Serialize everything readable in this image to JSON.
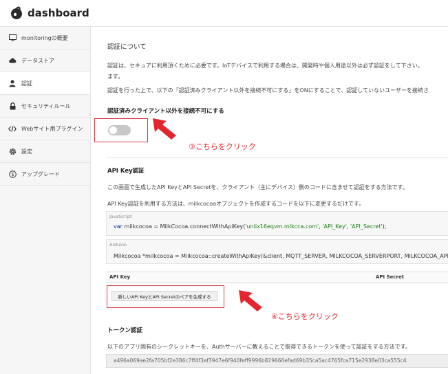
{
  "app": {
    "title": "dashboard"
  },
  "sidebar": {
    "items": [
      {
        "label": "monitoringの概要",
        "icon": "monitor-icon"
      },
      {
        "label": "データストア",
        "icon": "cloud-icon"
      },
      {
        "label": "認証",
        "icon": "user-icon",
        "active": true
      },
      {
        "label": "セキュリティルール",
        "icon": "lock-icon"
      },
      {
        "label": "Webサイト用プラグイン",
        "icon": "code-icon"
      },
      {
        "label": "設定",
        "icon": "gear-icon"
      },
      {
        "label": "アップグレード",
        "icon": "dollar-icon"
      }
    ]
  },
  "auth": {
    "title": "認証について",
    "desc1": "認証は、セキュアに利用頂くために必要です。IoTデバイスで利用する場合は、開発時や個人用途以外は必ず認証をして下さい。",
    "desc1b": "ます。",
    "desc2": "認証を行った上で、以下の「認証済みクライアント以外を接続不可にする」をONにすることで、認証していないユーザーを接続さ",
    "toggle_label": "認証済みクライアント以外を接続不可にする",
    "toggle_on": false
  },
  "annotations": {
    "step3": "③こちらをクリック",
    "step4": "④こちらをクリック",
    "color": "#e3262e"
  },
  "apikey": {
    "title": "API Key認証",
    "desc1": "この画面で生成したAPI KeyとAPI Secretを、クライアント（主にデバイス）側のコードに含ませて認証をする方法です。",
    "desc2": "API Key認証を利用する方法は、milkcocoaオブジェクトを作成するコードを以下に変更するだけです。",
    "js_tag": "JavaScript",
    "js_kw": "var",
    "js_pre": " milkcocoa = MilkCocoa.connectWithApiKey(",
    "js_s1": "'uniix16eqvm.mlkcca.com'",
    "js_sep1": ", ",
    "js_s2": "'API_Key'",
    "js_sep2": ", ",
    "js_s3": "'API_Secret'",
    "js_post": ");",
    "arduino_tag": "Arduino",
    "arduino_code": "Milkcocoa *milkcocoa = Milkcocoa::createWithApiKey(&client, MQTT_SERVER, MILKCOCOA_SERVERPORT, MILKCOCOA_APP_",
    "col_key": "API Key",
    "col_secret": "API Secret",
    "generate_button": "新しいAPI KeyとAPI Secretのペアを生成する"
  },
  "token": {
    "title": "トークン認証",
    "desc": "以下のアプリ固有のシークレットキーを、Authサーバーに教えることで取得できるトークンを使って認証をする方法です。",
    "secret": "a496a069ae2fa705bf2e386c7ff4f3ef3947e6f940feff9996b829666efad69b35ca5ac4765fca715e2938e03ca555c4"
  }
}
